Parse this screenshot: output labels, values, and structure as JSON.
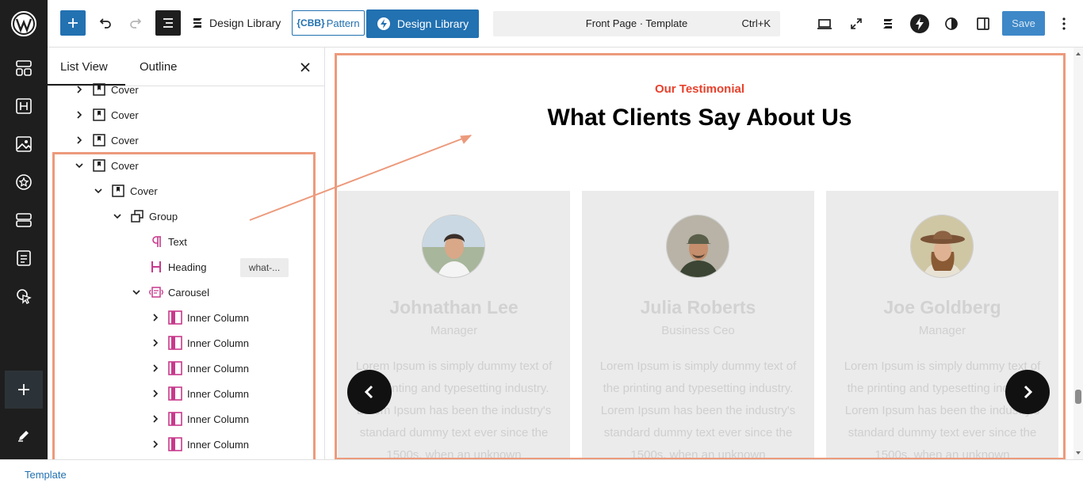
{
  "topbar": {
    "design_library_label": "Design Library",
    "pattern_prefix": "{CBB}",
    "pattern_label": "Pattern",
    "design_library_button_label": "Design Library",
    "command_title": "Front Page · Template",
    "command_shortcut": "Ctrl+K",
    "save_label": "Save"
  },
  "panel": {
    "tabs": [
      {
        "label": "List View"
      },
      {
        "label": "Outline"
      }
    ],
    "active_tab": "List View",
    "anchor_chip": "what-..."
  },
  "tree": [
    {
      "label": "Cover"
    },
    {
      "label": "Cover"
    },
    {
      "label": "Cover"
    },
    {
      "label": "Cover"
    },
    {
      "label": "Cover"
    },
    {
      "label": "Group"
    },
    {
      "label": "Text"
    },
    {
      "label": "Heading"
    },
    {
      "label": "Carousel"
    },
    {
      "label": "Inner Column"
    },
    {
      "label": "Inner Column"
    },
    {
      "label": "Inner Column"
    },
    {
      "label": "Inner Column"
    },
    {
      "label": "Inner Column"
    },
    {
      "label": "Inner Column"
    }
  ],
  "canvas": {
    "eyebrow": "Our Testimonial",
    "headline": "What Clients Say About Us",
    "cards": [
      {
        "name": "Johnathan Lee",
        "role": "Manager",
        "quote": "Lorem Ipsum is simply dummy text of the printing and typesetting industry. Lorem Ipsum has been the industry's standard dummy text ever since the 1500s, when an unknown"
      },
      {
        "name": "Julia Roberts",
        "role": "Business Ceo",
        "quote": "Lorem Ipsum is simply dummy text of the printing and typesetting industry. Lorem Ipsum has been the industry's standard dummy text ever since the 1500s, when an unknown"
      },
      {
        "name": "Joe Goldberg",
        "role": "Manager",
        "quote": "Lorem Ipsum is simply dummy text of the printing and typesetting industry. Lorem Ipsum has been the industry's standard dummy text ever since the 1500s, when an unknown"
      }
    ]
  },
  "footer": {
    "breadcrumb": "Template"
  },
  "colors": {
    "accent": "#2271b1",
    "eyebrow": "#e8412c",
    "highlight": "#ec9a7c",
    "rail": "#1e1e1e"
  },
  "icons": {
    "rail": [
      "wordpress-logo-icon",
      "patterns-icon",
      "heading-block-icon",
      "image-icon",
      "star-badge-icon",
      "layout-icon",
      "document-icon",
      "pointer-select-icon",
      "plus-icon",
      "pen-icon"
    ],
    "topbar": [
      "plus-icon",
      "undo-icon",
      "redo-icon",
      "list-view-icon",
      "stackable-icon",
      "stackable-bolt-icon",
      "desktop-icon",
      "fullscreen-icon",
      "stackable-icon",
      "bolt-circle-icon",
      "contrast-icon",
      "sidebar-toggle-icon",
      "more-vertical-icon"
    ]
  }
}
